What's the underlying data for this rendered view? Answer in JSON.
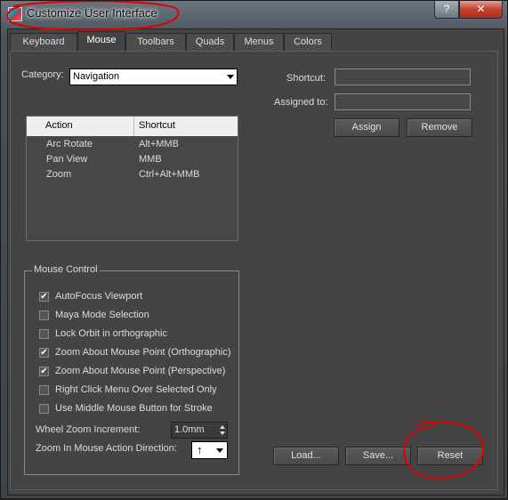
{
  "window": {
    "title": "Customize User Interface",
    "help_label": "?",
    "close_label": "✕"
  },
  "tabs": [
    {
      "label": "Keyboard"
    },
    {
      "label": "Mouse",
      "active": true
    },
    {
      "label": "Toolbars"
    },
    {
      "label": "Quads"
    },
    {
      "label": "Menus"
    },
    {
      "label": "Colors"
    }
  ],
  "category": {
    "label": "Category:",
    "value": "Navigation"
  },
  "action_list": {
    "headers": {
      "action": "Action",
      "shortcut": "Shortcut"
    },
    "rows": [
      {
        "action": "Arc Rotate",
        "shortcut": "Alt+MMB"
      },
      {
        "action": "Pan View",
        "shortcut": "MMB"
      },
      {
        "action": "Zoom",
        "shortcut": "Ctrl+Alt+MMB"
      }
    ]
  },
  "shortcut": {
    "label": "Shortcut:",
    "value": "",
    "assigned_label": "Assigned to:",
    "assigned_value": "",
    "assign_label": "Assign",
    "remove_label": "Remove"
  },
  "mouse_control": {
    "title": "Mouse Control",
    "options": [
      {
        "label": "AutoFocus Viewport",
        "checked": true
      },
      {
        "label": "Maya Mode Selection",
        "checked": false
      },
      {
        "label": "Lock Orbit in orthographic",
        "checked": false
      },
      {
        "label": "Zoom About Mouse Point (Orthographic)",
        "checked": true
      },
      {
        "label": "Zoom About Mouse Point (Perspective)",
        "checked": true
      },
      {
        "label": "Right Click Menu Over Selected Only",
        "checked": false
      },
      {
        "label": "Use Middle Mouse Button for Stroke",
        "checked": false
      }
    ],
    "wheel_zoom_label": "Wheel Zoom Increment:",
    "wheel_zoom_value": "1.0mm",
    "zoom_dir_label": "Zoom In Mouse Action Direction:",
    "zoom_dir_value": "↑"
  },
  "footer": {
    "load_label": "Load...",
    "save_label": "Save...",
    "reset_label": "Reset"
  },
  "colors": {
    "annotation": "#e00000"
  }
}
